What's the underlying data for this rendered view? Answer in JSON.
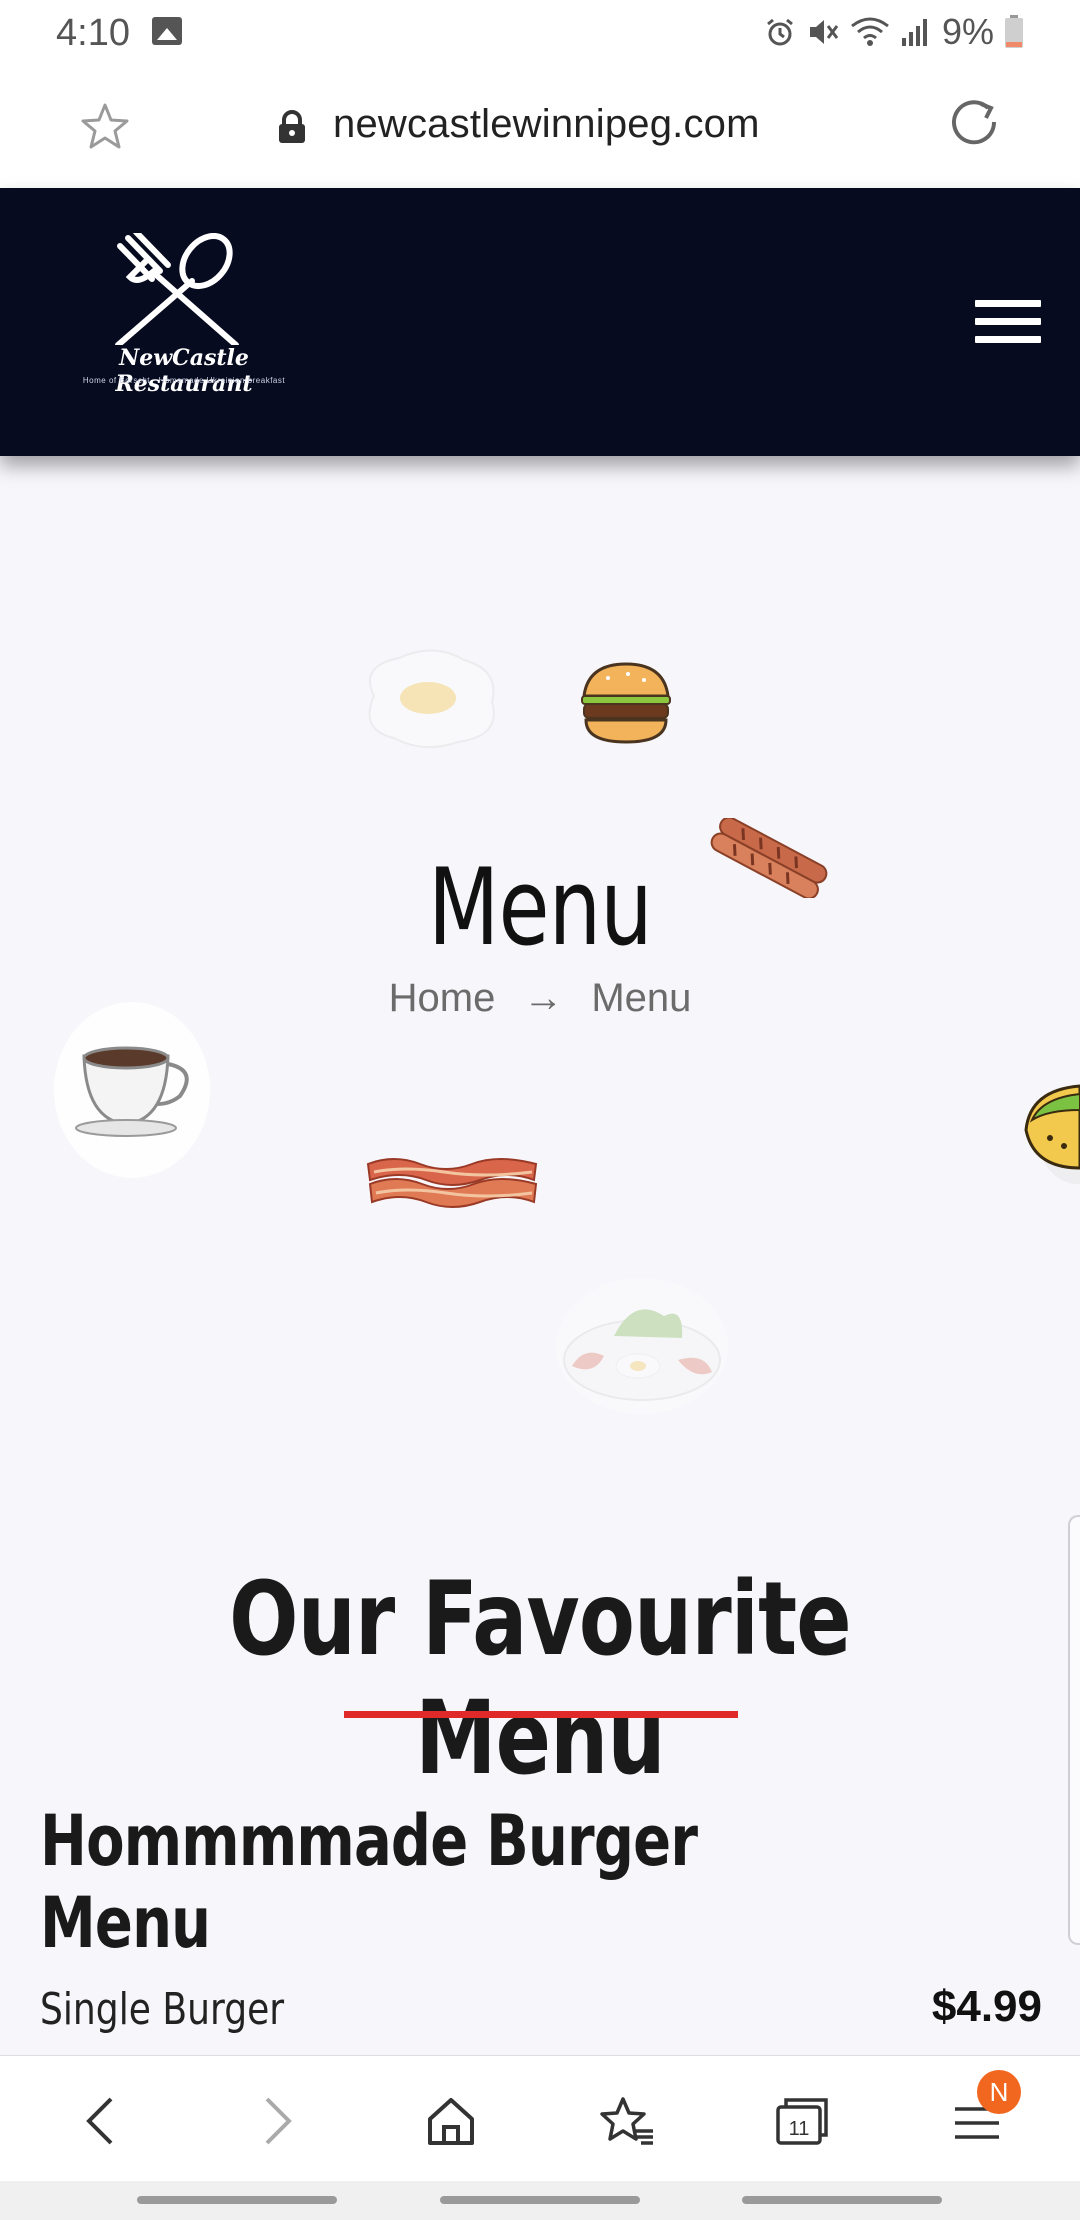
{
  "status_bar": {
    "time": "4:10",
    "battery_percent": "9%",
    "battery_level": 0.09,
    "icons": [
      "photo-icon",
      "alarm-icon",
      "mute-icon",
      "wifi-icon",
      "signal-icon",
      "battery-icon"
    ]
  },
  "browser": {
    "url": "newcastlewinnipeg.com",
    "icons": [
      "star-icon",
      "lock-icon",
      "reload-icon"
    ]
  },
  "site_header": {
    "logo_name": "NewCastle Restaurant",
    "logo_tagline": "Home of Borscht · Homemade Ukrainian breakfast",
    "menu_icon": "hamburger-icon"
  },
  "hero": {
    "title": "Menu",
    "breadcrumb": {
      "home": "Home",
      "separator": "→",
      "current": "Menu"
    },
    "decorations": [
      "fried-egg-icon",
      "burger-icon",
      "sausage-icon",
      "coffee-cup-icon",
      "bacon-icon",
      "taco-icon",
      "breakfast-plate-icon"
    ]
  },
  "menu_section": {
    "title": "Our Favourite Menu",
    "accent_color": "#e02a2a",
    "category": "Hommmmade Burger Menu",
    "items": [
      {
        "name": "Single Burger",
        "price": "$4.99"
      }
    ]
  },
  "bottom_nav": {
    "tabs_count": "11",
    "badge": "N",
    "icons": [
      "back-icon",
      "forward-icon",
      "home-icon",
      "bookmarks-icon",
      "tabs-icon",
      "menu-icon"
    ]
  },
  "colors": {
    "header_bg": "#070b20",
    "page_bg": "#f7f7fb",
    "badge": "#f1671f"
  }
}
